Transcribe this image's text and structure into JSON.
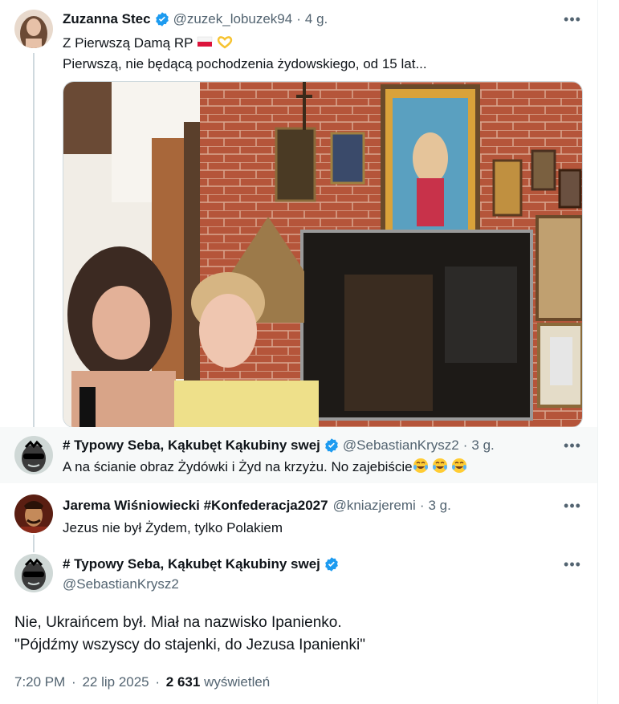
{
  "tweet1": {
    "author_name": "Zuzanna Stec",
    "handle": "@zuzek_lobuzek94",
    "time": "4 g.",
    "line1": "Z Pierwszą Damą RP",
    "line2": "Pierwszą,  nie będącą pochodzenia żydowskiego, od 15 lat..."
  },
  "reply1": {
    "author_name": "# Typowy Seba, Kąkubęt Kąkubiny swej",
    "handle": "@SebastianKrysz2",
    "time": "3 g.",
    "text": "A na ścianie obraz Żydówki i Żyd na krzyżu. No zajebiście"
  },
  "reply2": {
    "author_name": "Jarema Wiśniowiecki #Konfederacja2027",
    "handle": "@kniazjeremi",
    "time": "3 g.",
    "text": "Jezus nie był Żydem, tylko Polakiem"
  },
  "main_tweet": {
    "author_name": "# Typowy Seba, Kąkubęt Kąkubiny swej",
    "handle": "@SebastianKrysz2",
    "line1": "Nie, Ukraińcem był. Miał na nazwisko Ipanienko.",
    "line2": "\"Pójdźmy wszyscy do stajenki, do Jezusa Ipanienki\"",
    "time": "7:20 PM",
    "date": "22 lip 2025",
    "views_count": "2 631",
    "views_label": "wyświetleń"
  },
  "separator": "·",
  "more_label": "•••",
  "colors": {
    "verified": "#1d9bf0",
    "secondary_text": "#536471",
    "thread_line": "#cfd9de"
  },
  "icons": {
    "verified": "verified-badge-icon",
    "more": "more-icon",
    "laughing": "tears-of-joy-emoji",
    "flag": "poland-flag-emoji",
    "heart": "yellow-heart-hands-emoji"
  }
}
